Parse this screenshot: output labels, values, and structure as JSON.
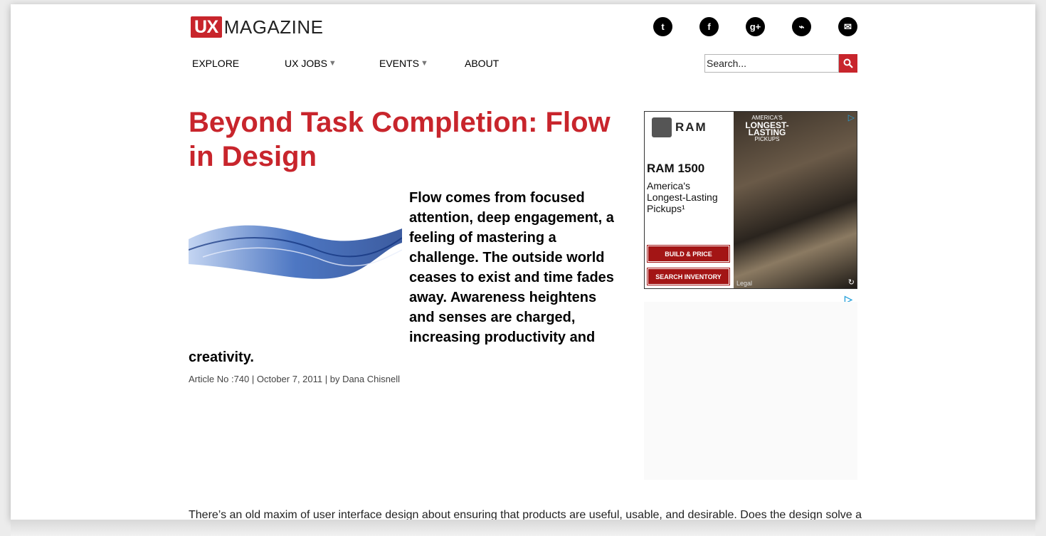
{
  "header": {
    "logo_ux": "UX",
    "logo_text": "MAGAZINE",
    "social": [
      {
        "name": "twitter-icon",
        "glyph": "t"
      },
      {
        "name": "facebook-icon",
        "glyph": "f"
      },
      {
        "name": "google-plus-icon",
        "glyph": "g+"
      },
      {
        "name": "rss-icon",
        "glyph": "⌁"
      },
      {
        "name": "email-icon",
        "glyph": "✉"
      }
    ]
  },
  "nav": {
    "items": [
      {
        "label": "EXPLORE",
        "dropdown": false
      },
      {
        "label": "UX JOBS",
        "dropdown": true
      },
      {
        "label": "EVENTS",
        "dropdown": true
      },
      {
        "label": "ABOUT",
        "dropdown": false
      }
    ],
    "caret": "▼"
  },
  "search": {
    "placeholder": "Search...",
    "button_icon": "search-icon"
  },
  "article": {
    "title": "Beyond Task Completion: Flow in Design",
    "lead": "Flow comes from focused attention, deep engagement, a feeling of mastering a challenge. The outside world ceases to exist and time fades away. Awareness heightens and senses are charged, increasing productivity and creativity.",
    "meta": "Article No :740 | October 7, 2011 | by Dana Chisnell",
    "body_first_line": "There’s an old maxim of user interface design about ensuring that products are useful, usable, and desirable. Does the design solve a"
  },
  "ad": {
    "brand": "RAM",
    "model": "RAM 1500",
    "copy": "America's Longest-Lasting Pickups¹",
    "headline_small": "AMERICA'S",
    "headline_big": "LONGEST-LASTING",
    "headline_sub": "PICKUPS",
    "button_build": "BUILD & PRICE",
    "button_search": "SEARCH INVENTORY",
    "legal": "Legal"
  },
  "colors": {
    "brand_red": "#c8252c",
    "link_blue": "#26a0da"
  }
}
